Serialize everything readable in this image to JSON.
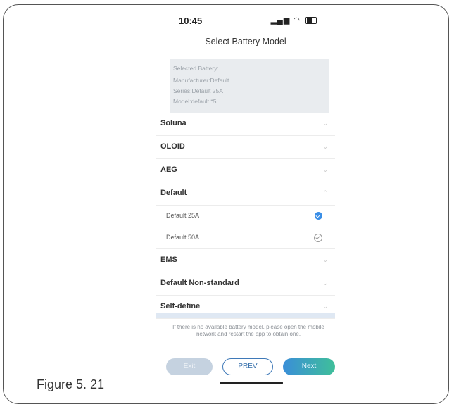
{
  "status": {
    "time": "10:45",
    "signal_text": "▂▄▆ ◠"
  },
  "page_title": "Select Battery Model",
  "selected": {
    "heading": "Selected Battery:",
    "manufacturer": "Manufacturer:Default",
    "series": "Series:Default 25A",
    "model": "Model:default *5"
  },
  "list": {
    "manufacturers": [
      {
        "label": "Soluna",
        "expanded": false
      },
      {
        "label": "OLOID",
        "expanded": false
      },
      {
        "label": "AEG",
        "expanded": false
      },
      {
        "label": "Default",
        "expanded": true
      },
      {
        "label": "EMS",
        "expanded": false
      },
      {
        "label": "Default Non-standard",
        "expanded": false
      },
      {
        "label": "Self-define",
        "expanded": false
      }
    ],
    "default_series": [
      {
        "label": "Default 25A",
        "selected": true
      },
      {
        "label": "Default 50A",
        "selected": false
      }
    ]
  },
  "notice": "If there is no available battery model, please open the mobile network and restart the app to obtain one.",
  "buttons": {
    "exit": "Exit",
    "prev": "PREV",
    "next": "Next"
  },
  "caption": "Figure 5. 21",
  "colors": {
    "accent": "#3a8ee6",
    "next_gradient_end": "#3fbf9a",
    "prev_border": "#3f79b8"
  }
}
